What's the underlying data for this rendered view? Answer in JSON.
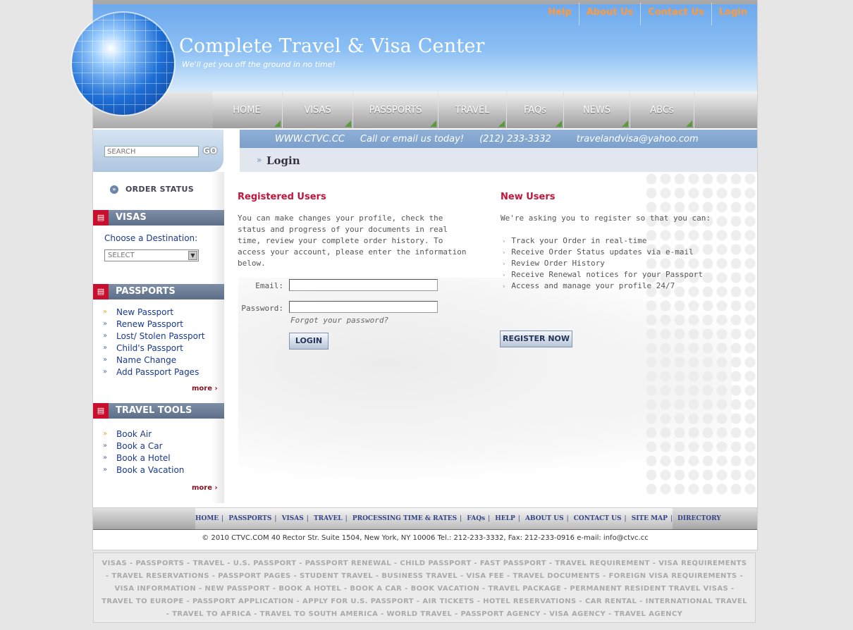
{
  "brand": {
    "title": "Complete Travel & Visa Center",
    "tagline": "We'll get you off the ground in no time!"
  },
  "toplinks": [
    "Help",
    "About Us",
    "Contact Us",
    "Login"
  ],
  "nav": [
    "HOME",
    "VISAS",
    "PASSPORTS",
    "TRAVEL",
    "FAQs",
    "NEWS",
    "ABCs"
  ],
  "search": {
    "placeholder": "SEARCH",
    "go": "GO"
  },
  "infobar": {
    "site": "WWW.CTVC.CC",
    "cta": "Call or email us today!",
    "phone": "(212) 233-3332",
    "email": "travelandvisa@yahoo.com"
  },
  "page_title": "Login",
  "sidebar": {
    "order_status": "ORDER STATUS",
    "visas": {
      "heading": "VISAS",
      "choose_label": "Choose a Destination:",
      "select_value": "SELECT"
    },
    "passports": {
      "heading": "PASSPORTS",
      "items": [
        "New Passport",
        "Renew Passport",
        "Lost/ Stolen Passport",
        "Child's Passport",
        "Name Change",
        "Add Passport Pages"
      ],
      "more": "more"
    },
    "travel_tools": {
      "heading": "TRAVEL TOOLS",
      "items": [
        "Book Air",
        "Book a Car",
        "Book a Hotel",
        "Book a Vacation"
      ],
      "more": "more"
    }
  },
  "registered": {
    "heading": "Registered Users",
    "text": "You can make changes your profile, check the status and progress of your documents in real time, review your complete order history. To access your account, please enter the information below.",
    "email_label": "Email:",
    "password_label": "Password:",
    "forgot": "Forgot your password?",
    "login_button": "LOGIN"
  },
  "new_users": {
    "heading": "New Users",
    "intro": "We're asking you to register so that you can:",
    "bullets": [
      "Track your Order in real-time",
      "Receive Order Status updates via e-mail",
      "Review Order History",
      "Receive Renewal notices for your Passport",
      "Access and manage your profile 24/7"
    ],
    "register_button": "REGISTER NOW"
  },
  "footer": {
    "links": [
      "HOME",
      "PASSPORTS",
      "VISAS",
      "TRAVEL",
      "PROCESSING TIME & RATES",
      "FAQs",
      "HELP",
      "ABOUT US",
      "CONTACT US",
      "SITE MAP",
      "DIRECTORY"
    ],
    "copyright": "© 2010 CTVC.COM  40 Rector Str. Suite 1504, New York, NY 10006 Tel.: 212-233-3332, Fax: 212-233-0916 e-mail: info@ctvc.cc"
  },
  "keywords": "VISAS - PASSPORTS - TRAVEL - U.S. PASSPORT - PASSPORT RENEWAL - CHILD PASSPORT - FAST PASSPORT - TRAVEL REQUIREMENT - VISA REQUIREMENTS - TRAVEL RESERVATIONS - PASSPORT PAGES - STUDENT TRAVEL - BUSINESS TRAVEL - VISA FEE - TRAVEL DOCUMENTS - FOREIGN VISA REQUIREMENTS - VISA INFORMATION - NEW PASSPORT - BOOK A HOTEL - BOOK A CAR - BOOK VACATION - TRAVEL PACKAGE - PERMANENT RESIDENT TRAVEL VISAS - TRAVEL TO EUROPE - PASSPORT APPLICATION - APPLY FOR U.S. PASSPORT - AIR TICKETS - HOTEL RESERVATIONS - CAR RENTAL - INTERNATIONAL TRAVEL - TRAVEL TO AFRICA - TRAVEL TO SOUTH AMERICA - WORLD TRAVEL - PASSPORT AGENCY - VISA AGENCY - TRAVEL AGENCY",
  "colors": {
    "accent_red": "#c0163c",
    "link_blue": "#1a3a8a",
    "header_blue": "#6aa7ec",
    "toplink_orange": "#ff9a3c"
  }
}
